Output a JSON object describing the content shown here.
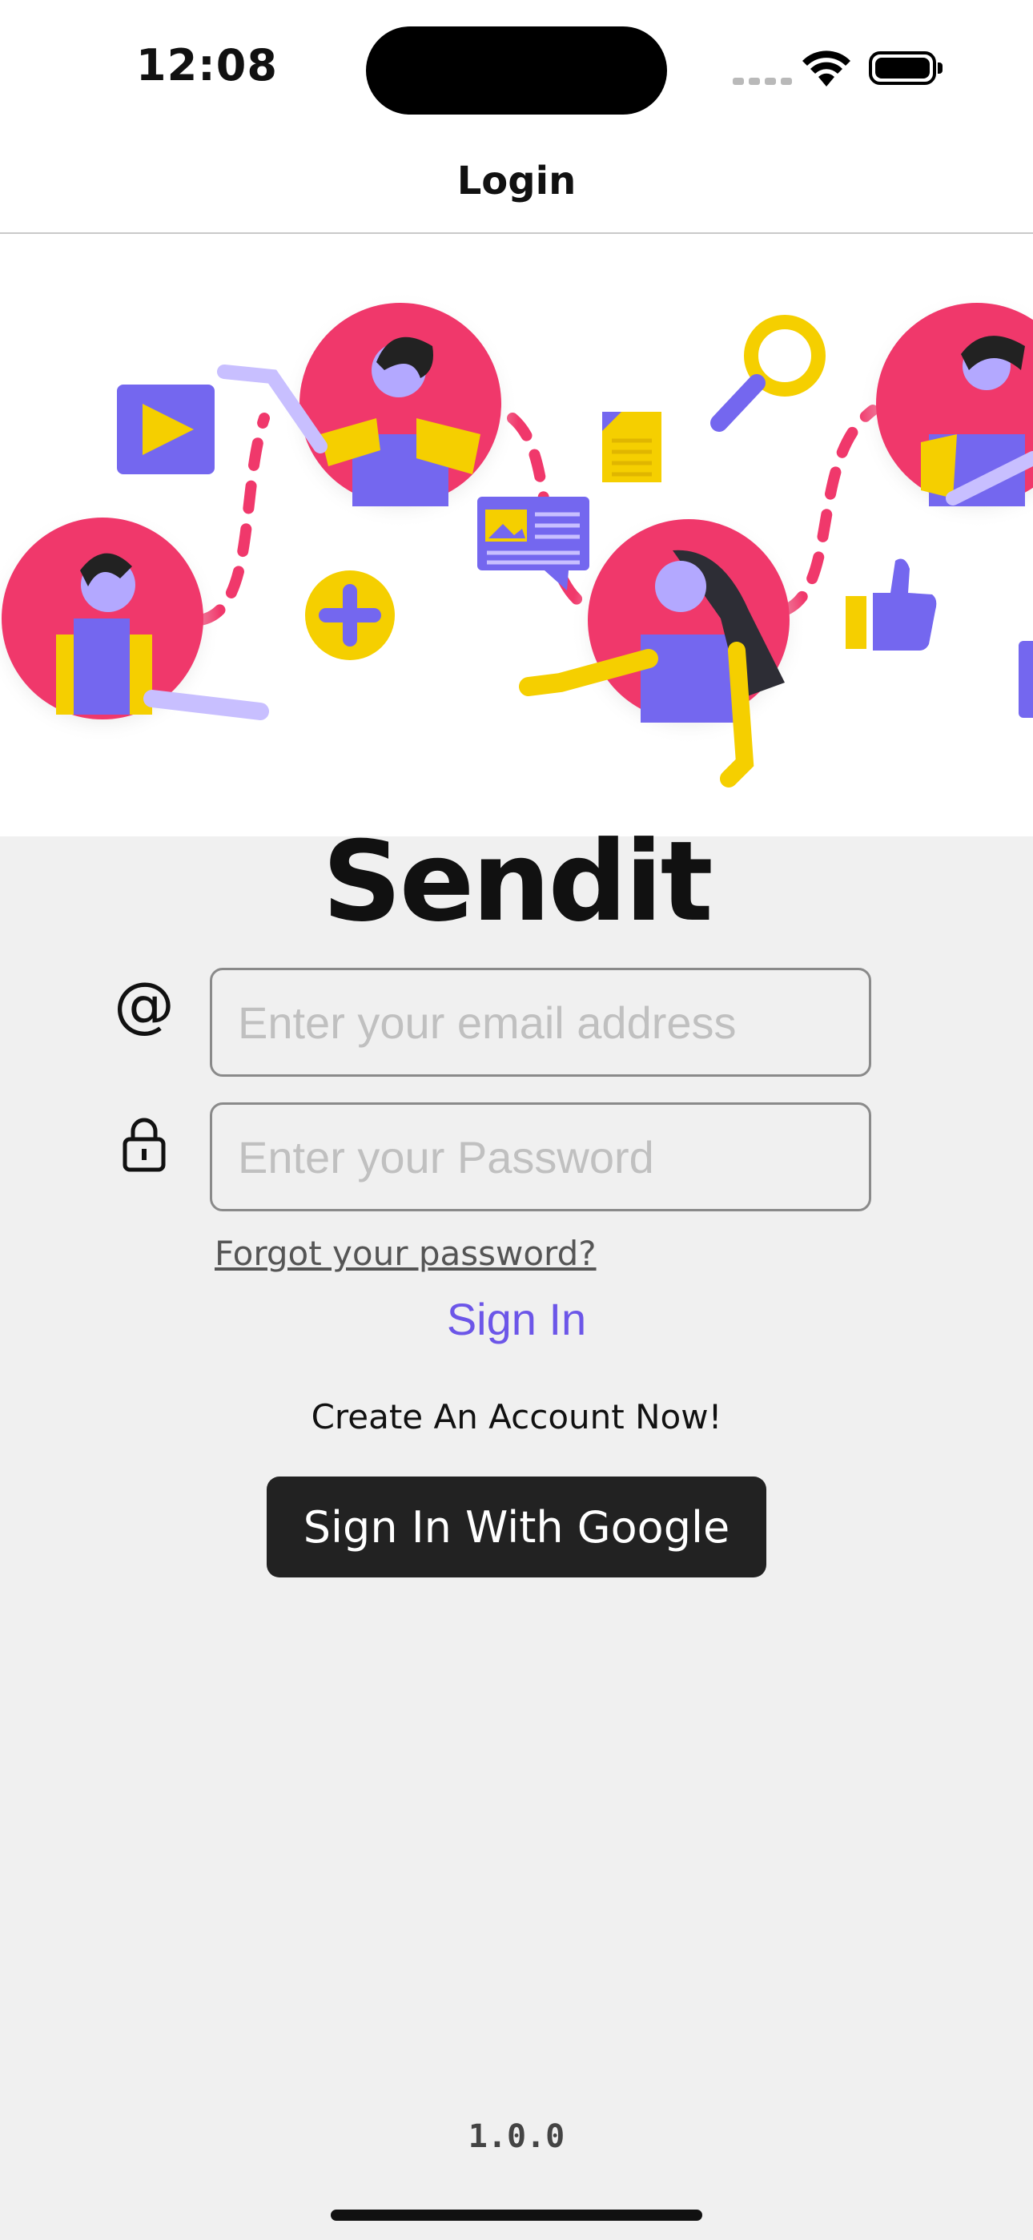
{
  "status_bar": {
    "time": "12:08"
  },
  "nav": {
    "title": "Login"
  },
  "app": {
    "name": "Sendit",
    "version": "1.0.0"
  },
  "form": {
    "email_placeholder": "Enter your email address",
    "password_placeholder": "Enter your Password",
    "forgot_label": "Forgot your password?",
    "signin_label": "Sign In",
    "create_account_label": "Create An Account Now!",
    "google_label": "Sign In With Google"
  },
  "icons": {
    "email": "at-sign-icon",
    "password": "lock-icon"
  },
  "colors": {
    "accent": "#6c56e8",
    "pink": "#f0386b",
    "yellow": "#f5cf00",
    "purple": "#7467ef",
    "button_dark": "#222222"
  }
}
